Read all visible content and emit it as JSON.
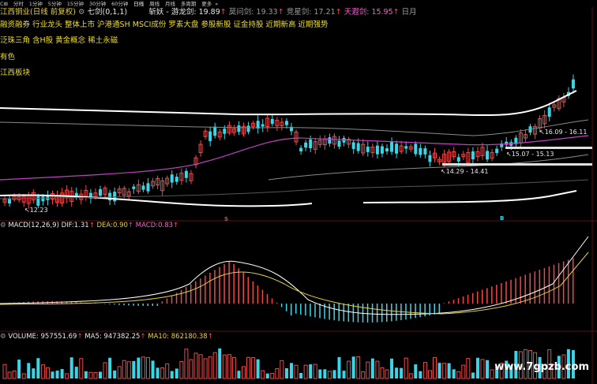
{
  "toolbar": {
    "items": [
      "分时",
      "1分钟",
      "5分钟",
      "15分钟",
      "30分钟",
      "60分钟",
      "日线",
      "周线",
      "月线",
      "多周期",
      "更多"
    ],
    "active_index": 6
  },
  "title": {
    "stock": "江西铜业(日线 前复权)",
    "indicator": "七剑(0,1,1)",
    "xieyao_label": "斩妖",
    "youlong_label": "游龙剑",
    "youlong_value": "19.89",
    "moye_label": "莫问剑",
    "moye_value": "19.33",
    "jingxing_label": "竞星剑",
    "jingxing_value": "17.21",
    "tianxia_label": "天遐剑",
    "tianxia_value": "15.95",
    "ri_label": "日月"
  },
  "tags": {
    "row1": "融资融券 行业龙头 整体上市 沪港通SH MSCI成份 罗素大盘 参股新股 证金持股 近期新高 近期强势",
    "row2": "泛珠三角 含H股 黄金概念 稀土永磁",
    "row3": "有色",
    "row4": "江西板块"
  },
  "price_labels": {
    "low": "12.23",
    "range1": "14.29 - 14.41",
    "range2": "15.07 - 15.13",
    "range3": "16.09 - 16.11"
  },
  "markers": {
    "s": "S",
    "b": "B"
  },
  "macd": {
    "label": "MACD(12,26,9)",
    "dif_label": "DIF:",
    "dif_value": "1.31",
    "dea_label": "DEA:",
    "dea_value": "0.90",
    "macd_label": "MACD:",
    "macd_value": "0.83"
  },
  "volume": {
    "label": "VOLUME:",
    "value": "957551.69",
    "ma5_label": "MA5:",
    "ma5_value": "947382.25",
    "ma10_label": "MA10:",
    "ma10_value": "862180.38"
  },
  "watermark": "www.7gpzb.com",
  "colors": {
    "up": "#f04848",
    "down": "#3ad6e8",
    "line": "#ffffff",
    "ma": "#c040c0",
    "band": "#8a8a8a"
  }
}
